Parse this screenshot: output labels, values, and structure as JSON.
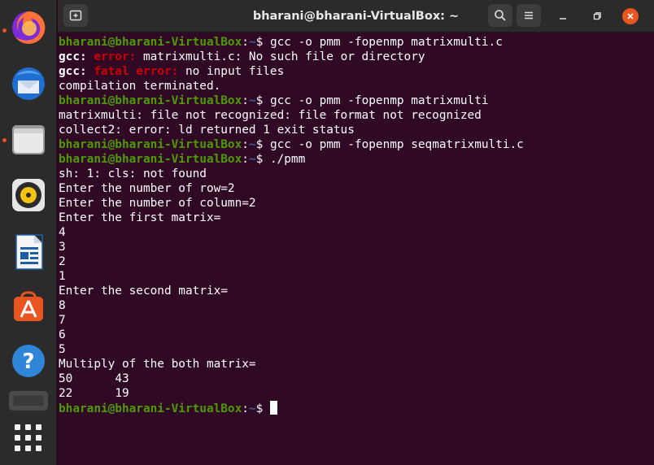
{
  "window": {
    "title": "bharani@bharani-VirtualBox: ~"
  },
  "dock": {
    "items": [
      {
        "name": "Firefox",
        "icon": "firefox-icon",
        "running": true
      },
      {
        "name": "Thunderbird",
        "icon": "thunderbird-icon",
        "running": false
      },
      {
        "name": "Files",
        "icon": "files-icon",
        "running": true
      },
      {
        "name": "Rhythmbox",
        "icon": "rhythmbox-icon",
        "running": false
      },
      {
        "name": "LibreOffice Writer",
        "icon": "writer-icon",
        "running": false
      },
      {
        "name": "Ubuntu Software",
        "icon": "software-icon",
        "running": false
      },
      {
        "name": "Help",
        "icon": "help-icon",
        "running": false
      },
      {
        "name": "Terminal",
        "icon": "terminal-icon",
        "running": true
      }
    ],
    "show_apps": "apps-grid-icon"
  },
  "terminal": {
    "prompt": {
      "user_host": "bharani@bharani-VirtualBox",
      "colon": ":",
      "path": "~",
      "symbol": "$"
    },
    "lines": [
      {
        "type": "prompt",
        "cmd": " gcc -o pmm -fopenmp matrixmulti.c"
      },
      {
        "type": "gcc",
        "prefix": "gcc:",
        "label": " error:",
        "text": " matrixmulti.c: No such file or directory"
      },
      {
        "type": "gcc",
        "prefix": "gcc:",
        "label": " fatal error:",
        "text": " no input files"
      },
      {
        "type": "text",
        "text": "compilation terminated."
      },
      {
        "type": "prompt",
        "cmd": " gcc -o pmm -fopenmp matrixmulti"
      },
      {
        "type": "text",
        "text": "matrixmulti: file not recognized: file format not recognized"
      },
      {
        "type": "text",
        "text": "collect2: error: ld returned 1 exit status"
      },
      {
        "type": "prompt",
        "cmd": " gcc -o pmm -fopenmp seqmatrixmulti.c"
      },
      {
        "type": "prompt",
        "cmd": " ./pmm"
      },
      {
        "type": "text",
        "text": "sh: 1: cls: not found"
      },
      {
        "type": "text",
        "text": "Enter the number of row=2"
      },
      {
        "type": "text",
        "text": "Enter the number of column=2"
      },
      {
        "type": "text",
        "text": "Enter the first matrix="
      },
      {
        "type": "text",
        "text": "4"
      },
      {
        "type": "text",
        "text": "3"
      },
      {
        "type": "text",
        "text": "2"
      },
      {
        "type": "text",
        "text": "1"
      },
      {
        "type": "text",
        "text": "Enter the second matrix="
      },
      {
        "type": "text",
        "text": "8"
      },
      {
        "type": "text",
        "text": "7"
      },
      {
        "type": "text",
        "text": "6"
      },
      {
        "type": "text",
        "text": "5"
      },
      {
        "type": "text",
        "text": "Multiply of the both matrix="
      },
      {
        "type": "text",
        "text": "50\t43"
      },
      {
        "type": "text",
        "text": "22\t19"
      },
      {
        "type": "prompt",
        "cmd": " ",
        "cursor": true
      }
    ]
  },
  "colors": {
    "background": "#300a24",
    "prompt_host": "#4e9a06",
    "prompt_path": "#3465a4",
    "error": "#cc0000",
    "close_button": "#e95420"
  }
}
